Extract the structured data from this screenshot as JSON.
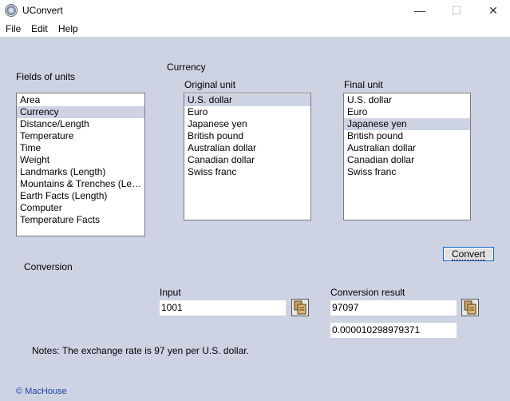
{
  "window": {
    "title": "UConvert",
    "minimize_glyph": "—",
    "maximize_glyph": "☐",
    "close_glyph": "✕"
  },
  "menu": {
    "items": [
      "File",
      "Edit",
      "Help"
    ]
  },
  "fields": {
    "heading": "Fields of units",
    "items": [
      "Area",
      "Currency",
      "Distance/Length",
      "Temperature",
      "Time",
      "Weight",
      "Landmarks (Length)",
      "Mountains & Trenches (Length)",
      "Earth Facts (Length)",
      "Computer",
      "Temperature Facts"
    ],
    "selected_index": 1
  },
  "category": {
    "title": "Currency"
  },
  "original_unit": {
    "heading": "Original unit",
    "items": [
      "U.S. dollar",
      "Euro",
      "Japanese yen",
      "British pound",
      "Australian dollar",
      "Canadian dollar",
      "Swiss franc"
    ],
    "selected_index": 0
  },
  "final_unit": {
    "heading": "Final unit",
    "items": [
      "U.S. dollar",
      "Euro",
      "Japanese yen",
      "British pound",
      "Australian dollar",
      "Canadian dollar",
      "Swiss franc"
    ],
    "selected_index": 2
  },
  "convert_button": {
    "label": "Convert"
  },
  "conversion": {
    "heading": "Conversion",
    "input_label": "Input",
    "input_value": "1001",
    "result_label": "Conversion result",
    "result_value": "97097",
    "inverse_value": "0.000010298979371"
  },
  "notes": {
    "text": "Notes:  The exchange rate is 97 yen per U.S. dollar."
  },
  "footer": {
    "copyright": "© MacHouse"
  },
  "colors": {
    "client_bg": "#cdd3e3",
    "selection_bg": "#cdd3e3",
    "button_border": "#0a64c8",
    "copyright_text": "#1a44a8"
  },
  "icons": {
    "app": "app-globe-icon",
    "copy": "copy-clipboard-icon"
  }
}
